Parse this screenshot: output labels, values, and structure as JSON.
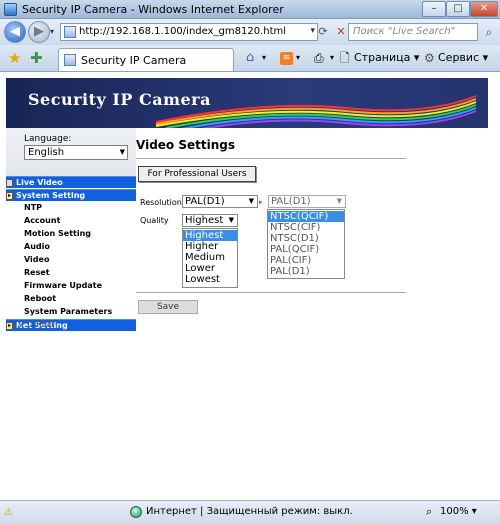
{
  "window": {
    "title": "Security IP Camera - Windows Internet Explorer"
  },
  "address": {
    "url": "http://192.168.1.100/index_gm8120.html"
  },
  "search": {
    "placeholder": "Поиск \"Live Search\""
  },
  "tab": {
    "title": "Security IP Camera"
  },
  "commands": {
    "page": "Страница",
    "tools": "Сервис"
  },
  "banner": {
    "title": "Security IP Camera"
  },
  "sidebar": {
    "language_label": "Language:",
    "language_value": "English",
    "items": [
      {
        "label": "Live Video",
        "type": "main"
      },
      {
        "label": "System Setting",
        "type": "main"
      },
      {
        "label": "NTP",
        "type": "sub"
      },
      {
        "label": "Account",
        "type": "sub"
      },
      {
        "label": "Motion Setting",
        "type": "sub"
      },
      {
        "label": "Audio",
        "type": "sub"
      },
      {
        "label": "Video",
        "type": "sub"
      },
      {
        "label": "Reset",
        "type": "sub"
      },
      {
        "label": "Firmware Update",
        "type": "sub"
      },
      {
        "label": "Reboot",
        "type": "sub"
      },
      {
        "label": "System Parameters",
        "type": "sub"
      },
      {
        "label": "Net Setting",
        "type": "main"
      }
    ],
    "version": "V 1.3008"
  },
  "main": {
    "title": "Video Settings",
    "professional_button": "For Professional Users",
    "resolution_label": "Resolution",
    "resolution_value": "PAL(D1)",
    "resolution2_value": "PAL(D1)",
    "resolution2_options": [
      "NTSC(QCIF)",
      "NTSC(CIF)",
      "NTSC(D1)",
      "PAL(QCIF)",
      "PAL(CIF)",
      "PAL(D1)"
    ],
    "quality_label": "Quality",
    "quality_value": "Highest",
    "quality_options": [
      "Highest",
      "Higher",
      "Medium",
      "Lower",
      "Lowest"
    ],
    "save_button": "Save"
  },
  "status": {
    "text": "Интернет | Защищенный режим: выкл.",
    "zoom": "100%"
  }
}
